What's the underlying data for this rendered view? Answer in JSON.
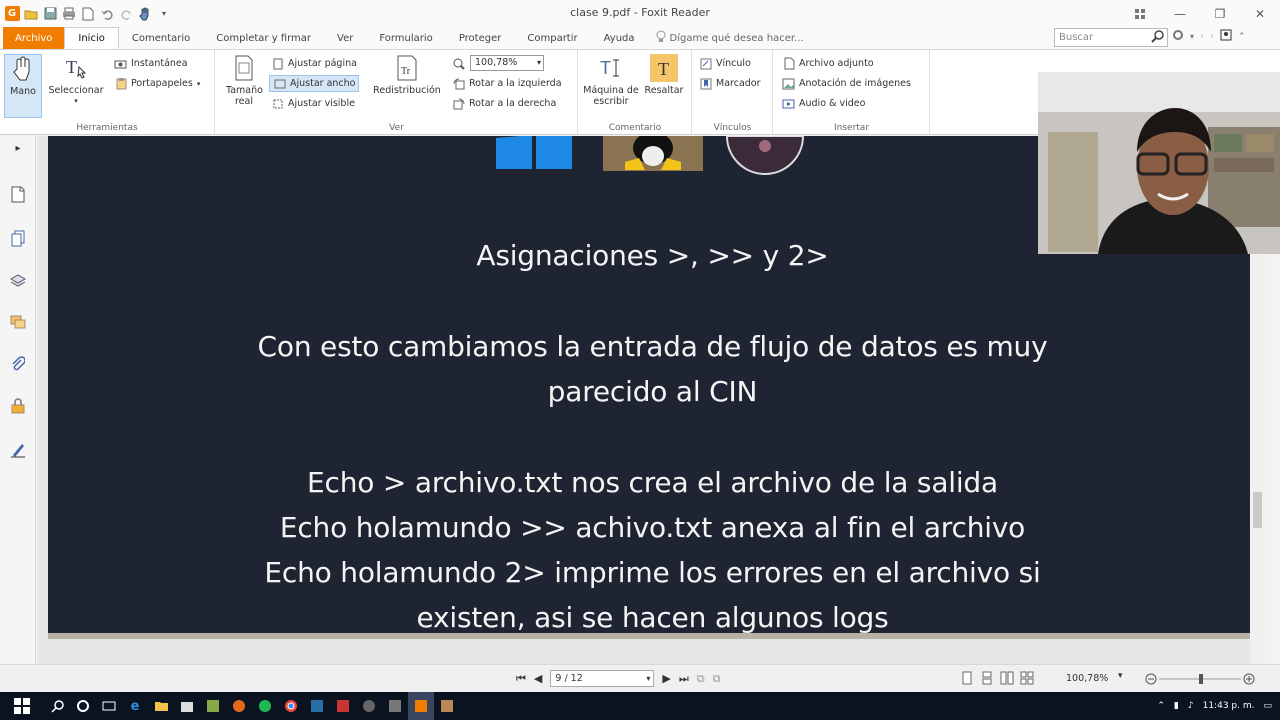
{
  "window": {
    "title": "clase 9.pdf - Foxit Reader"
  },
  "ribbon_tabs": [
    "Archivo",
    "Inicio",
    "Comentario",
    "Completar y firmar",
    "Ver",
    "Formulario",
    "Proteger",
    "Compartir",
    "Ayuda"
  ],
  "tell_me": "Dígame qué desea hacer...",
  "search": {
    "placeholder": "Buscar"
  },
  "ribbon": {
    "herramientas": {
      "label": "Herramientas",
      "mano": "Mano",
      "seleccionar": "Seleccionar",
      "instantanea": "Instantánea",
      "portapapeles": "Portapapeles"
    },
    "ver": {
      "label": "Ver",
      "tamano_real": "Tamaño real",
      "ajustar_pagina": "Ajustar página",
      "ajustar_ancho": "Ajustar ancho",
      "ajustar_visible": "Ajustar visible",
      "redistribucion": "Redistribución",
      "zoom": "100,78%",
      "rotar_izq": "Rotar a la izquierda",
      "rotar_der": "Rotar a la derecha"
    },
    "comentario": {
      "label": "Comentario",
      "maquina": "Máquina de escribir",
      "resaltar": "Resaltar"
    },
    "vinculos": {
      "label": "Vínculos",
      "vinculo": "Vínculo",
      "marcador": "Marcador"
    },
    "insertar": {
      "label": "Insertar",
      "archivo_adjunto": "Archivo adjunto",
      "anotacion": "Anotación de imágenes",
      "audio": "Audio & video"
    }
  },
  "slide": {
    "heading": "Asignaciones >, >> y 2>",
    "para1_l1": "Con esto cambiamos la entrada de flujo de datos es muy",
    "para1_l2": "parecido al CIN",
    "line1": "Echo > archivo.txt nos crea el archivo de la salida",
    "line2": "Echo holamundo >> achivo.txt anexa al fin el archivo",
    "line3": "Echo holamundo 2> imprime los errores en el archivo si",
    "line4": "existen, asi se hacen algunos logs"
  },
  "status": {
    "page": "9 / 12",
    "zoom": "100,78%"
  },
  "taskbar": {
    "time": "11:43 p. m."
  },
  "colors": {
    "accent": "#f07c00",
    "slide_bg": "#1e2431",
    "taskbar": "#0b1220"
  }
}
